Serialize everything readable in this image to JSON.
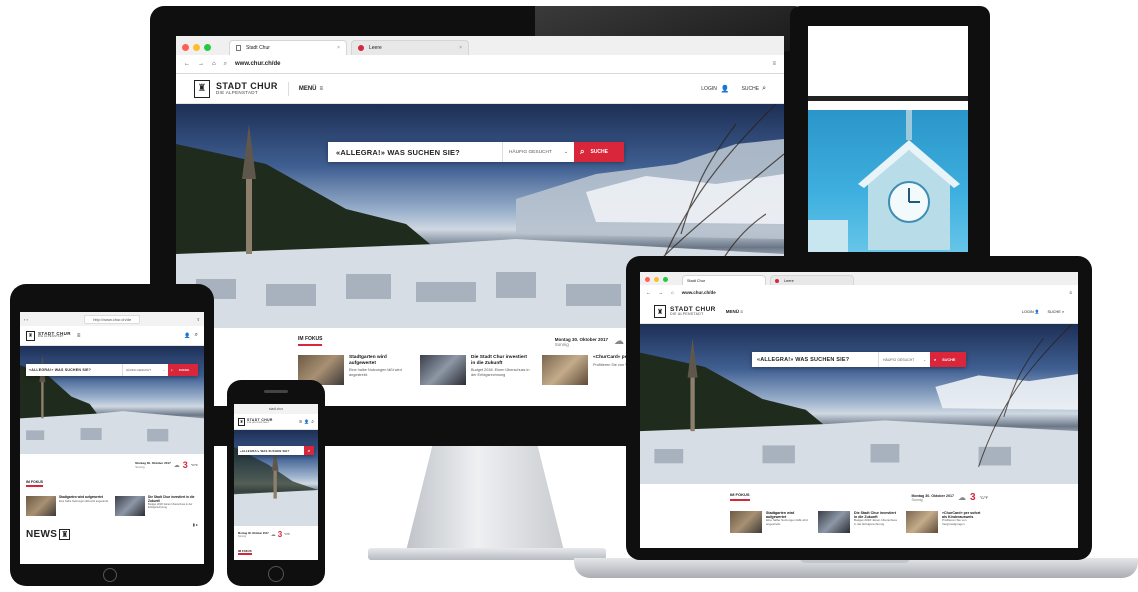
{
  "desktop": {
    "tabs": [
      {
        "label": "Stadt Chur",
        "icon": "page-icon"
      },
      {
        "label": "Leere",
        "icon": "red-circle-icon"
      }
    ],
    "url": "www.chur.ch/de",
    "brand_name": "STADT CHUR",
    "brand_tagline": "DIE ALPENSTADT",
    "menu_label": "MENÜ",
    "login_label": "LOGIN",
    "search_label": "SUCHE",
    "search_prompt": "«ALLEGRA!» WAS SUCHEN SIE?",
    "search_dropdown": "HÄUFIG GESUCHT",
    "search_button": "SUCHE",
    "section_title": "IM FOKUS",
    "date_text": "Montag 30. Oktober 2017",
    "weather_sub": "Sonnig",
    "news": [
      {
        "title": "Stadtgarten wird aufgewertet",
        "desc": "Eine halbe Nutzungen läßt wird angestrebt."
      },
      {
        "title": "Die Stadt Chur investiert in die Zukunft",
        "desc": "Budget 2018: Einen Überschuss in der Erfolgsrechnung"
      },
      {
        "title": "«ChurCard» pers",
        "desc": "Profitieren Sie von Vergünstigungen"
      }
    ]
  },
  "laptop": {
    "tabs": [
      {
        "label": "Stadt Chur"
      },
      {
        "label": "Leere"
      }
    ],
    "url": "www.chur.ch/de",
    "brand_name": "STADT CHUR",
    "brand_tagline": "DIE ALPENSTADT",
    "menu_label": "MENÜ",
    "login_label": "LOGIN",
    "search_label": "SUCHE",
    "search_prompt": "«ALLEGRA!» WAS SUCHEN SIE?",
    "search_dropdown": "HÄUFIG GESUCHT",
    "search_button": "SUCHE",
    "section_title": "IM FOKUS",
    "date_text": "Montag 30. Oktober 2017",
    "weather_sub": "Sonnig",
    "temp": "3",
    "temp_unit": "°C/°F",
    "news": [
      {
        "title": "Stadtgarten wird aufgewertet",
        "desc": "Eine halbe Nutzungen läßt wird angestrebt."
      },
      {
        "title": "Die Stadt Chur investiert in die Zukunft",
        "desc": "Budget 2018: Einen Überschuss in der Erfolgsrechnung"
      },
      {
        "title": "«ChurCard» per sofort als Kinderausweis",
        "desc": "Profitieren Sie von Vergünstigungen"
      }
    ]
  },
  "tablet": {
    "url": "http://www.chur.ch/de",
    "brand_name": "STADT CHUR",
    "brand_tagline": "DIE ALPENSTADT",
    "search_prompt": "«ALLEGRA!» WAS SUCHEN SIE?",
    "search_dropdown": "HÄUFIG GESUCHT",
    "search_button": "SUCHE",
    "section_title": "IM FOKUS",
    "date_text": "Montag 30. Oktober 2017",
    "weather_sub": "Sonnig",
    "temp": "3",
    "temp_unit": "°C/°F",
    "news": [
      {
        "title": "Stadtgarten wird aufgewertet",
        "desc": "Eine halbe Nutzungen läßt wird angestrebt."
      },
      {
        "title": "Die Stadt Chur investiert in die Zukunft",
        "desc": "Budget 2018: Einen Überschuss in der Erfolgsrechnung"
      }
    ],
    "news_heading": "NEWS"
  },
  "phone": {
    "url": "stadt.chur",
    "brand_name": "STADT CHUR",
    "brand_tagline": "DIE ALPENSTADT",
    "search_prompt": "«ALLEGRA!» WAS SUCHEN SIE?",
    "date_text": "Montag 30. Oktober 2017",
    "weather_sub": "Sonnig",
    "temp": "3",
    "temp_unit": "°C/°F",
    "section_title": "IM FOKUS"
  },
  "colors": {
    "accent": "#d9263a",
    "frame": "#0f0f10"
  }
}
